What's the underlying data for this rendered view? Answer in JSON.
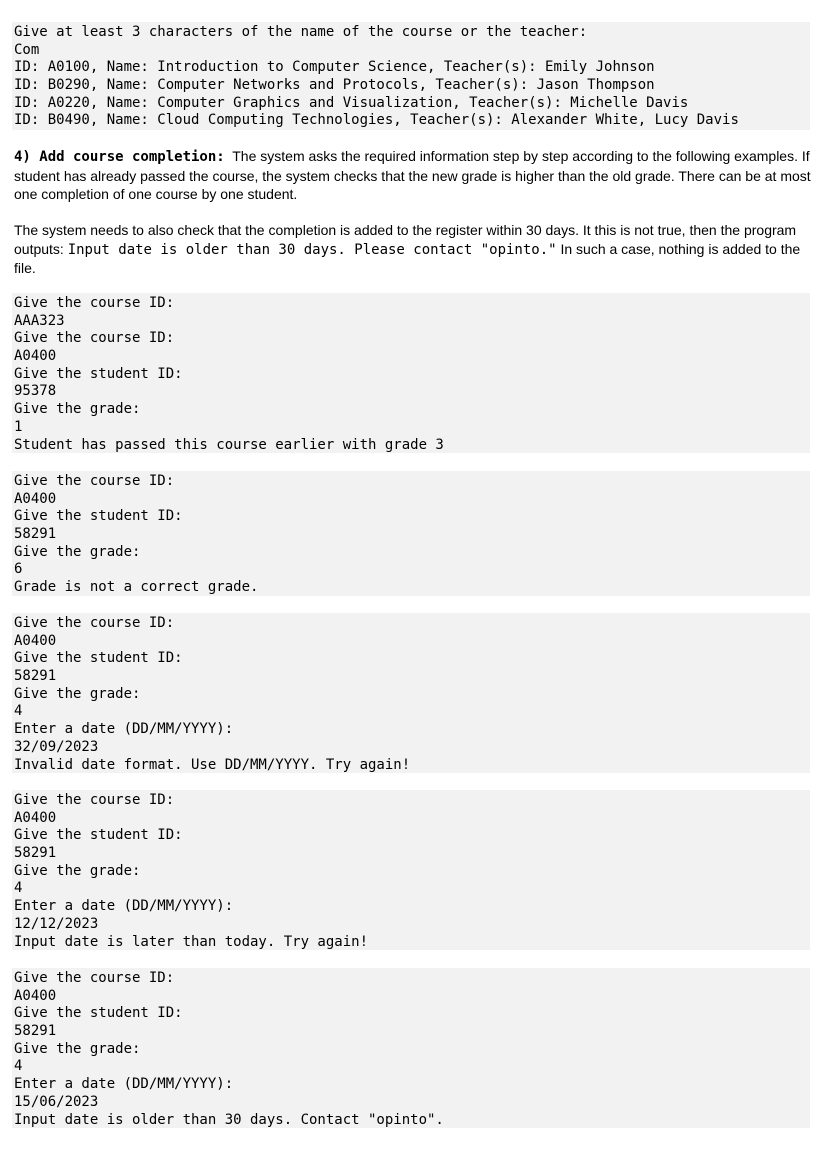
{
  "search_block": {
    "lines": [
      "Give at least 3 characters of the name of the course or the teacher:",
      "Com",
      "ID: A0100, Name: Introduction to Computer Science, Teacher(s): Emily Johnson",
      "ID: B0290, Name: Computer Networks and Protocols, Teacher(s): Jason Thompson",
      "ID: A0220, Name: Computer Graphics and Visualization, Teacher(s): Michelle Davis",
      "ID: B0490, Name: Cloud Computing Technologies, Teacher(s): Alexander White, Lucy Davis"
    ]
  },
  "section4": {
    "heading": "4) Add course completion:",
    "para1": "The system asks the required information step by step according to the following examples. If student has already passed the course, the system checks that the new grade is higher than the old grade. There can be at most one completion of one course by one student.",
    "para2_before": "The system needs to also check that the completion is added to the register within 30 days. It this is not true, then the program outputs: ",
    "para2_code": "Input date is older than 30 days. Please contact \"opinto.\"",
    "para2_after": " In such a case, nothing is added to the file."
  },
  "examples": [
    {
      "lines": [
        "Give the course ID:",
        "AAA323",
        "Give the course ID:",
        "A0400",
        "Give the student ID:",
        "95378",
        "Give the grade:",
        "1",
        "Student has passed this course earlier with grade 3"
      ]
    },
    {
      "lines": [
        "Give the course ID:",
        "A0400",
        "Give the student ID:",
        "58291",
        "Give the grade:",
        "6",
        "Grade is not a correct grade."
      ]
    },
    {
      "lines": [
        "Give the course ID:",
        "A0400",
        "Give the student ID:",
        "58291",
        "Give the grade:",
        "4",
        "Enter a date (DD/MM/YYYY):",
        "32/09/2023",
        "Invalid date format. Use DD/MM/YYYY. Try again!"
      ]
    },
    {
      "lines": [
        "Give the course ID:",
        "A0400",
        "Give the student ID:",
        "58291",
        "Give the grade:",
        "4",
        "Enter a date (DD/MM/YYYY):",
        "12/12/2023",
        "Input date is later than today. Try again!"
      ]
    },
    {
      "lines": [
        "Give the course ID:",
        "A0400",
        "Give the student ID:",
        "58291",
        "Give the grade:",
        "4",
        "Enter a date (DD/MM/YYYY):",
        "15/06/2023",
        "Input date is older than 30 days. Contact \"opinto\"."
      ]
    }
  ]
}
